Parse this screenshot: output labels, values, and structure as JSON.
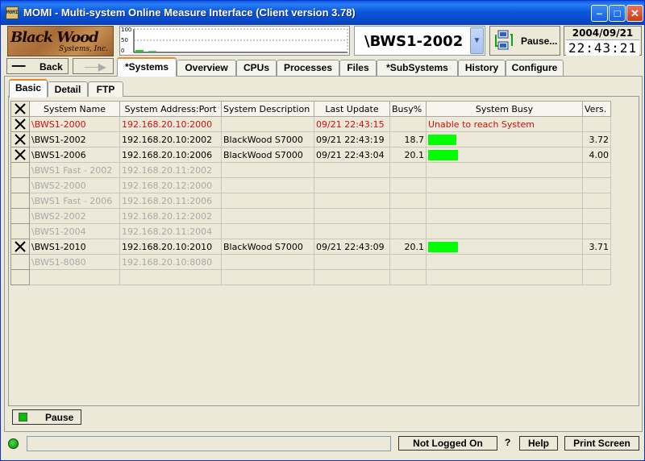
{
  "window": {
    "title": "MOMI - Multi-system Online Measure Interface (Client version 3.78)",
    "app_icon_text": "MOMI"
  },
  "logo": {
    "line1": "Black Wood",
    "line2": "Systems, Inc."
  },
  "graph": {
    "y_ticks": [
      "100",
      "50",
      "0"
    ],
    "bars": [
      10,
      6
    ]
  },
  "system_selector": {
    "selected": "\\BWS1-2002"
  },
  "pause_top": {
    "label": "Pause..."
  },
  "clock": {
    "date": "2004/09/21",
    "time": "22:43:21"
  },
  "nav": {
    "back_label": "Back"
  },
  "main_tabs": [
    {
      "label": "*Systems",
      "active": true
    },
    {
      "label": "Overview"
    },
    {
      "label": "CPUs"
    },
    {
      "label": "Processes"
    },
    {
      "label": "Files"
    },
    {
      "label": "*SubSystems"
    },
    {
      "label": "History"
    },
    {
      "label": "Configure"
    }
  ],
  "sub_tabs": [
    {
      "label": "Basic",
      "active": true
    },
    {
      "label": "Detail"
    },
    {
      "label": "FTP"
    }
  ],
  "table": {
    "headers": [
      "System Name",
      "System Address:Port",
      "System Description",
      "Last Update",
      "Busy%",
      "System Busy",
      "Vers."
    ],
    "rows": [
      {
        "checked": true,
        "state": "error",
        "name": "\\BWS1-2000",
        "address": "192.168.20.10:2000",
        "description": "",
        "last_update": "09/21 22:43:15",
        "busy_pct": "",
        "busy_text": "Unable to reach System",
        "busy_fraction": null,
        "version": ""
      },
      {
        "checked": true,
        "state": "ok",
        "name": "\\BWS1-2002",
        "address": "192.168.20.10:2002",
        "description": "BlackWood S7000",
        "last_update": "09/21 22:43:19",
        "busy_pct": "18.7",
        "busy_text": "",
        "busy_fraction": 0.187,
        "version": "3.72"
      },
      {
        "checked": true,
        "state": "ok",
        "name": "\\BWS1-2006",
        "address": "192.168.20.10:2006",
        "description": "BlackWood S7000",
        "last_update": "09/21 22:43:04",
        "busy_pct": "20.1",
        "busy_text": "",
        "busy_fraction": 0.201,
        "version": "4.00"
      },
      {
        "checked": false,
        "state": "inactive",
        "name": "\\BWS1 Fast - 2002",
        "address": "192.168.20.11:2002",
        "description": "",
        "last_update": "",
        "busy_pct": "",
        "busy_text": "",
        "busy_fraction": null,
        "version": ""
      },
      {
        "checked": false,
        "state": "inactive",
        "name": "\\BWS2-2000",
        "address": "192.168.20.12:2000",
        "description": "",
        "last_update": "",
        "busy_pct": "",
        "busy_text": "",
        "busy_fraction": null,
        "version": ""
      },
      {
        "checked": false,
        "state": "inactive",
        "name": "\\BWS1 Fast - 2006",
        "address": "192.168.20.11:2006",
        "description": "",
        "last_update": "",
        "busy_pct": "",
        "busy_text": "",
        "busy_fraction": null,
        "version": ""
      },
      {
        "checked": false,
        "state": "inactive",
        "name": "\\BWS2-2002",
        "address": "192.168.20.12:2002",
        "description": "",
        "last_update": "",
        "busy_pct": "",
        "busy_text": "",
        "busy_fraction": null,
        "version": ""
      },
      {
        "checked": false,
        "state": "inactive",
        "name": "\\BWS1-2004",
        "address": "192.168.20.11:2004",
        "description": "",
        "last_update": "",
        "busy_pct": "",
        "busy_text": "",
        "busy_fraction": null,
        "version": ""
      },
      {
        "checked": true,
        "state": "ok",
        "name": "\\BWS1-2010",
        "address": "192.168.20.10:2010",
        "description": "BlackWood S7000",
        "last_update": "09/21 22:43:09",
        "busy_pct": "20.1",
        "busy_text": "",
        "busy_fraction": 0.201,
        "version": "3.71"
      },
      {
        "checked": false,
        "state": "inactive",
        "name": "\\BWS1-8080",
        "address": "192.168.20.10:8080",
        "description": "",
        "last_update": "",
        "busy_pct": "",
        "busy_text": "",
        "busy_fraction": null,
        "version": ""
      }
    ]
  },
  "pause_button": {
    "label": "Pause"
  },
  "statusbar": {
    "status_text": "",
    "login_label": "Not Logged On",
    "question": "?",
    "help_label": "Help",
    "print_label": "Print Screen"
  },
  "colors": {
    "busy_bar": "#00ff00",
    "error_text": "#d01010",
    "inactive_text": "#a8a8a8",
    "active_tab_accent": "#e68b2c"
  }
}
